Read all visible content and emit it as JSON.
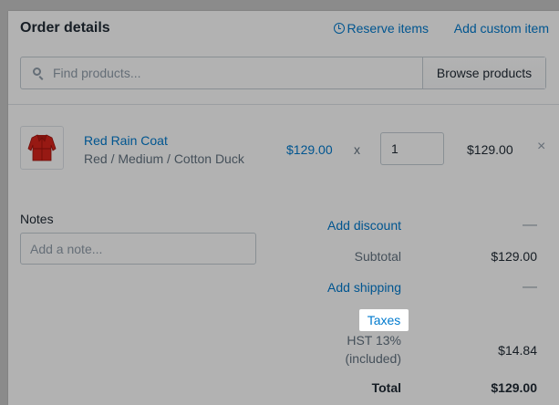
{
  "header": {
    "title": "Order details",
    "reserve_label": "Reserve items",
    "custom_label": "Add custom item"
  },
  "search": {
    "placeholder": "Find products...",
    "browse_label": "Browse products"
  },
  "line_item": {
    "name": "Red Rain Coat",
    "variant": "Red / Medium / Cotton Duck",
    "price": "$129.00",
    "times": "x",
    "quantity": "1",
    "total": "$129.00",
    "remove": "×"
  },
  "notes": {
    "label": "Notes",
    "placeholder": "Add a note..."
  },
  "summary": {
    "discount_label": "Add discount",
    "discount_value": "—",
    "subtotal_label": "Subtotal",
    "subtotal_value": "$129.00",
    "shipping_label": "Add shipping",
    "shipping_value": "—",
    "taxes_label": "Taxes",
    "tax_line1": "HST 13%",
    "tax_line2": "(included)",
    "tax_value": "$14.84",
    "total_label": "Total",
    "total_value": "$129.00"
  },
  "colors": {
    "accent": "#007ace",
    "text": "#212b36",
    "muted": "#637381"
  }
}
